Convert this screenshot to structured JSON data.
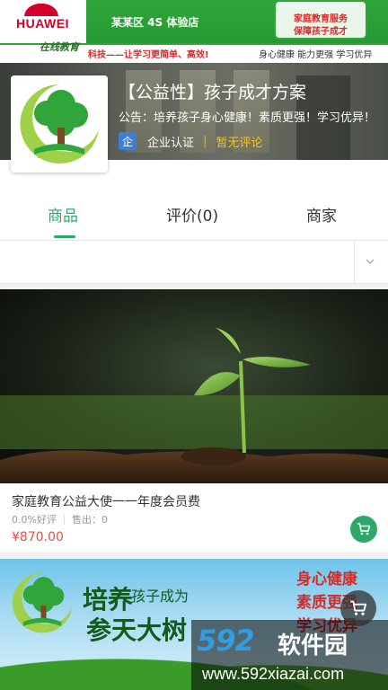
{
  "banner": {
    "brand": "HUAWEI",
    "dealer_text": "某某区 4S 体验店",
    "online_text": "在线教育",
    "slogan": "科技——让学习更简单、高效!",
    "tags": "身心健康   能力更强   学习优异",
    "badge_line1": "家庭教育服务",
    "badge_line2": "保障孩子成才"
  },
  "shop": {
    "title": "【公益性】孩子成才方案",
    "notice": "公告：培养孩子身心健康！素质更强！学习优异！",
    "enterprise_icon": "企",
    "enterprise_label": "企业认证",
    "separator": "|",
    "review_status": "暂无评论"
  },
  "tabs": {
    "products": "商品",
    "reviews": "评价(0)",
    "merchant": "商家"
  },
  "product": {
    "name": "家庭教育公益大使一一年度会员费",
    "rating": "0.0%好评",
    "sold": "售出：0",
    "price": "¥870.00",
    "image_icon": "seedling-image",
    "cart_icon": "cart-icon"
  },
  "product2": {
    "title_big": "培养",
    "title_small": "孩子成为",
    "title_line2": "参天大树",
    "right_line1": "身心健康",
    "right_line2": "素质更强",
    "right_line3": "学习优异"
  },
  "watermark": {
    "logo_num": "592",
    "logo_cn": "软件园",
    "url": "www.592xiazai.com"
  },
  "colors": {
    "accent": "#2ea868",
    "price": "#d9534f",
    "enterprise": "#3d7fd6",
    "review_status": "#f5c518"
  }
}
